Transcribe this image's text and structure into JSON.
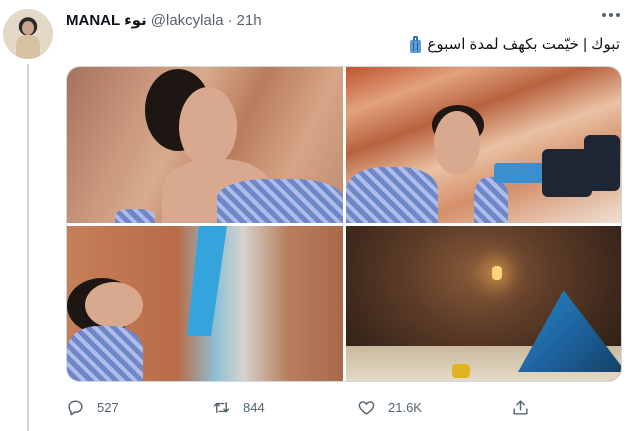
{
  "tweet": {
    "display_name": "MANAL نوء",
    "handle": "@lakcylala",
    "separator": "·",
    "time": "21h",
    "text": "تبوك | خيّمت بكهف لمدة اسبوع",
    "text_emoji": "luggage-icon"
  },
  "media": {
    "count": 4
  },
  "actions": {
    "reply_count": "527",
    "retweet_count": "844",
    "like_count": "21.6K"
  },
  "icons": {
    "reply": "reply-icon",
    "retweet": "retweet-icon",
    "like": "heart-icon",
    "share": "share-icon",
    "more": "more-icon"
  },
  "colors": {
    "secondary_text": "#536471",
    "border": "#cfd9de",
    "primary_text": "#0f1419"
  }
}
